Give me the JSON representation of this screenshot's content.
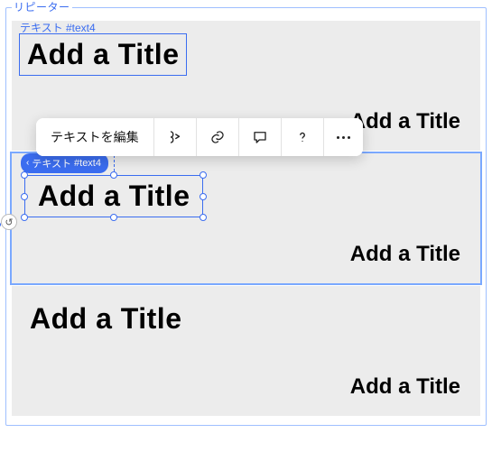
{
  "repeater": {
    "label": "リピーター",
    "text_element_label_japanese": "テキスト",
    "text_element_id": "#text4",
    "cells": [
      {
        "title_a": "Add a Title",
        "title_b": "Add a Title"
      },
      {
        "title_a": "Add a Title",
        "title_b": "Add a Title"
      },
      {
        "title_a": "Add a Title",
        "title_b": "Add a Title"
      }
    ]
  },
  "toolbar": {
    "edit_text_label": "テキストを編集"
  },
  "selected": {
    "pill_prefix": "テキスト",
    "pill_id": "#text4"
  }
}
